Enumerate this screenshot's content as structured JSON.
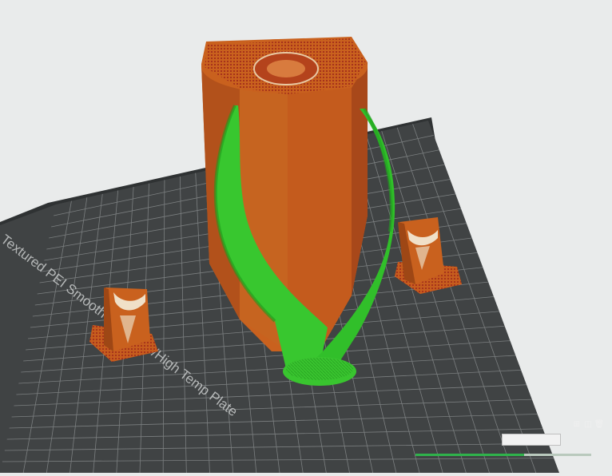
{
  "plate": {
    "label": "Textured PEI Smooth PEI Plate/High Temp Plate",
    "color": "#3f4243",
    "grid_color": "#9a9d9e",
    "frame_color": "#2c2e2f"
  },
  "objects": {
    "main_color": "#c9611e",
    "main_shadow_color": "#9e4715",
    "support_color": "#38c72f",
    "support_shadow_color": "#1f9a1c",
    "infill_color": "#b0361c"
  },
  "viewport_toolbar": {
    "items": [
      {
        "name": "view-cube-icon",
        "glyph": "⊞"
      },
      {
        "name": "orientation-icon",
        "glyph": "◫"
      },
      {
        "name": "trash-icon",
        "glyph": "🗑"
      }
    ]
  },
  "status": {
    "text": "",
    "progress": 0.62
  }
}
